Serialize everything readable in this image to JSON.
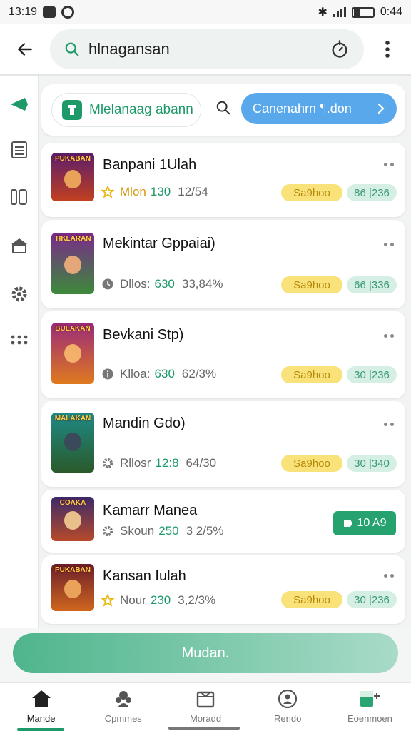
{
  "status_bar": {
    "time": "13:19",
    "battery": "0:44"
  },
  "search": {
    "query": "hlnagansan"
  },
  "filter": {
    "chip_label": "Mlelanaag abann",
    "primary_chip_label": "Canenahrn ¶.don"
  },
  "items": [
    {
      "title": "Banpani 1Ulah",
      "thumb_text": "PUKABAN",
      "meta_label": "Mlon",
      "meta_value": "130",
      "meta_pct": "12/54",
      "tag": "Sa9hoo",
      "count": "86 |236",
      "meta_icon": "star-icon"
    },
    {
      "title": "Mekintar Gppaiai)",
      "thumb_text": "TIKLARAN",
      "meta_label": "Dllos:",
      "meta_value": "630",
      "meta_pct": "33,84%",
      "tag": "Sa9hoo",
      "count": "66 |336",
      "meta_icon": "clock-icon"
    },
    {
      "title": "Bevkani Stp)",
      "thumb_text": "BULAKAN",
      "meta_label": "Klloa:",
      "meta_value": "630",
      "meta_pct": "62/3%",
      "tag": "Sa9hoo",
      "count": "30 |236",
      "meta_icon": "info-icon"
    },
    {
      "title": "Mandin Gdo)",
      "thumb_text": "MALAKAN",
      "meta_label": "Rllosr",
      "meta_value": "12:8",
      "meta_pct": "64/30",
      "tag": "Sa9hoo",
      "count": "30 |340",
      "meta_icon": "gear-icon"
    },
    {
      "title": "Kamarr Manea",
      "thumb_text": "COAKA",
      "meta_label": "Skoun",
      "meta_value": "250",
      "meta_pct": "3 2/5%",
      "button": "10 A9",
      "meta_icon": "gear-icon"
    },
    {
      "title": "Kansan Iulah",
      "thumb_text": "PUKABAN",
      "meta_label": "Nour",
      "meta_value": "230",
      "meta_pct": "3,2/3%",
      "tag": "Sa9hoo",
      "count": "30 |236",
      "meta_icon": "star-icon"
    }
  ],
  "action_button": "Mudan.",
  "bottom_nav": [
    {
      "label": "Mande",
      "icon": "home-icon"
    },
    {
      "label": "Cpmmes",
      "icon": "group-icon"
    },
    {
      "label": "Moradd",
      "icon": "box-icon"
    },
    {
      "label": "Rendo",
      "icon": "profile-icon"
    },
    {
      "label": "Eoenmoen",
      "icon": "add-icon"
    }
  ],
  "colors": {
    "accent": "#1e9a68",
    "chip_blue": "#5aa8ec",
    "tag_yellow": "#f9e27a",
    "tag_green": "#d6efe5"
  }
}
